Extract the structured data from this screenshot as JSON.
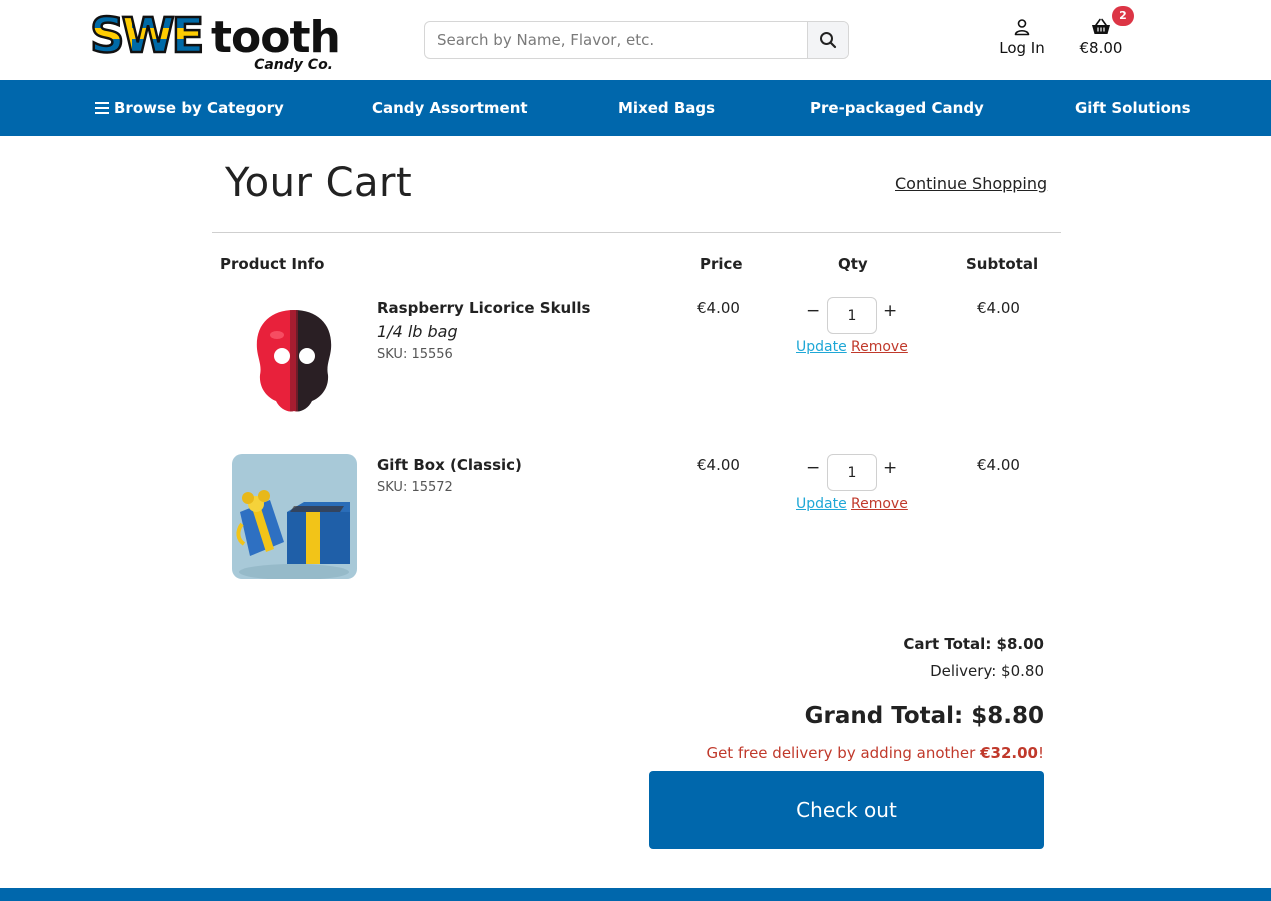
{
  "brand": {
    "logo_part1": "SWE",
    "logo_part2": "tooth",
    "logo_sub": "Candy Co."
  },
  "search": {
    "placeholder": "Search by Name, Flavor, etc.",
    "icon": "search-icon"
  },
  "account": {
    "login_label": "Log In",
    "icon": "user-icon"
  },
  "mini_cart": {
    "amount": "€8.00",
    "count": "2",
    "icon": "basket-icon"
  },
  "nav": {
    "items": [
      {
        "label": "Browse by Category",
        "icon": "menu-icon"
      },
      {
        "label": "Candy Assortment"
      },
      {
        "label": "Mixed Bags"
      },
      {
        "label": "Pre-packaged Candy"
      },
      {
        "label": "Gift Solutions"
      }
    ]
  },
  "page": {
    "title": "Your Cart",
    "continue_label": "Continue Shopping"
  },
  "table": {
    "headers": [
      "Product Info",
      "Price",
      "Qty",
      "Subtotal"
    ]
  },
  "items": [
    {
      "name": "Raspberry Licorice Skulls",
      "variant": "1/4 lb bag",
      "sku": "SKU: 15556",
      "price": "€4.00",
      "qty": "1",
      "subtotal": "€4.00",
      "minus": "−",
      "plus": "+",
      "update_label": "Update",
      "remove_label": "Remove"
    },
    {
      "name": "Gift Box (Classic)",
      "sku": "SKU: 15572",
      "price": "€4.00",
      "qty": "1",
      "subtotal": "€4.00",
      "minus": "−",
      "plus": "+",
      "update_label": "Update",
      "remove_label": "Remove"
    }
  ],
  "totals": {
    "cart_total": "Cart Total: $8.00",
    "delivery": "Delivery: $0.80",
    "grand_total": "Grand Total: $8.80",
    "free_prefix": "Get free delivery by adding another ",
    "free_amount": "€32.00",
    "free_suffix": "!",
    "checkout_label": "Check out"
  },
  "colors": {
    "brand_blue": "#0067ac",
    "alert_red": "#c0392b",
    "badge_red": "#dc3545",
    "link_blue": "#1ea7d6",
    "swedish_yellow": "#fecc02"
  }
}
